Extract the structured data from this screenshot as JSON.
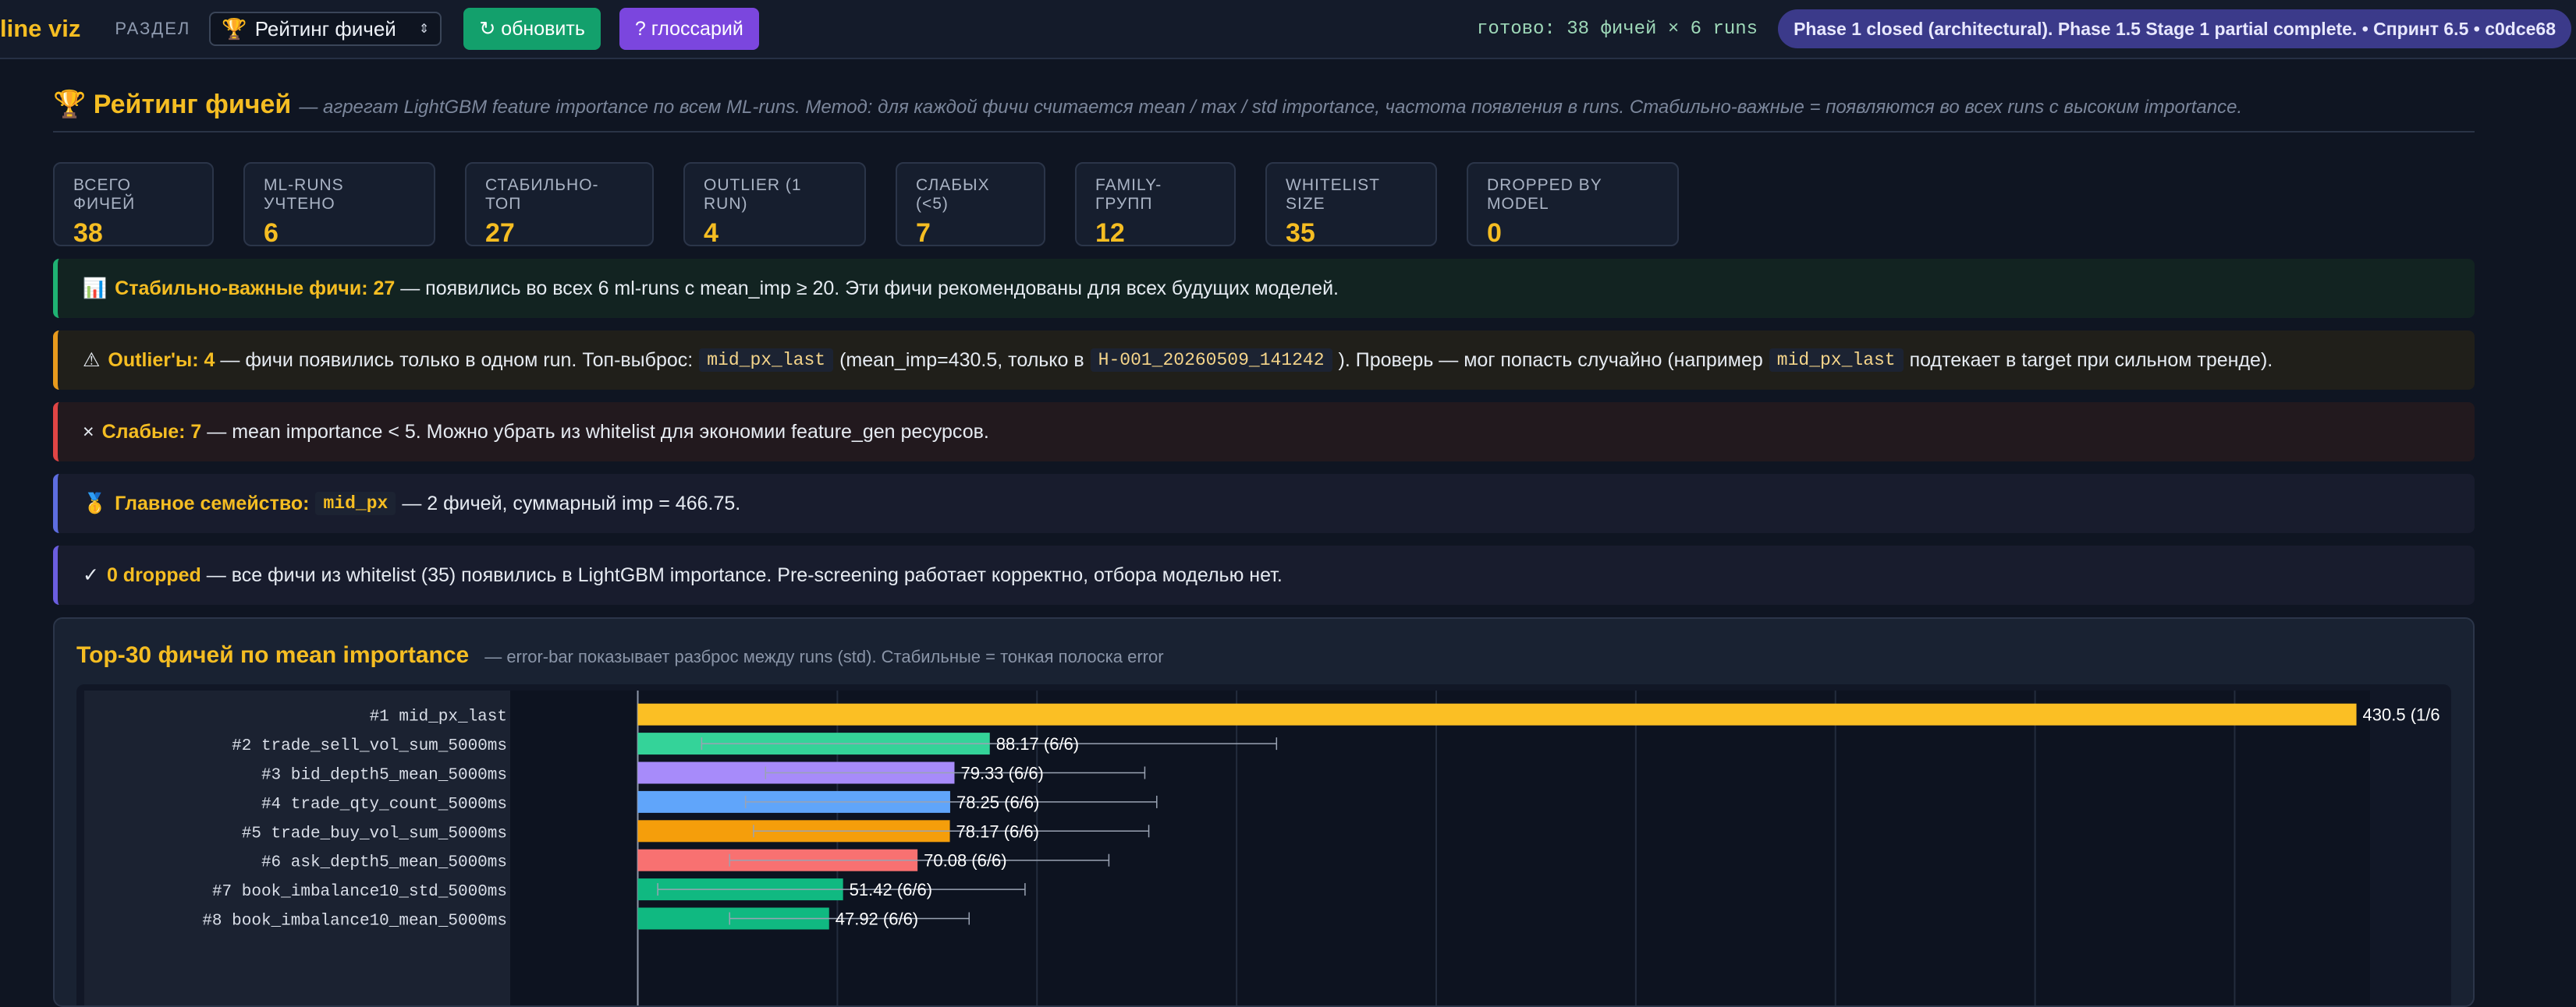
{
  "topbar": {
    "brand": "line viz",
    "section_label": "РАЗДЕЛ",
    "section_select": {
      "icon": "🏆",
      "value": "Рейтинг фичей"
    },
    "refresh_button": "↻ обновить",
    "glossary_button": "? глоссарий",
    "status": "готово: 38 фичей × 6 runs",
    "phase_pill": "Phase 1 closed (architectural). Phase 1.5 Stage 1 partial complete. • Спринт 6.5 • c0dce68"
  },
  "header": {
    "icon": "🏆",
    "title": "Рейтинг фичей",
    "subtitle": "— агрегат LightGBM feature importance по всем ML-runs. Метод: для каждой фичи считается mean / max / std importance, частота появления в runs. Стабильно-важные = появляются во всех runs с высоким importance."
  },
  "stats": [
    {
      "label": "ВСЕГО ФИЧЕЙ",
      "value": "38"
    },
    {
      "label": "ML-RUNS УЧТЕНО",
      "value": "6"
    },
    {
      "label": "СТАБИЛЬНО-ТОП",
      "value": "27"
    },
    {
      "label": "OUTLIER (1 RUN)",
      "value": "4"
    },
    {
      "label": "СЛАБЫХ (<5)",
      "value": "7"
    },
    {
      "label": "FAMILY-ГРУПП",
      "value": "12"
    },
    {
      "label": "WHITELIST SIZE",
      "value": "35"
    },
    {
      "label": "DROPPED BY MODEL",
      "value": "0"
    }
  ],
  "alerts": {
    "stable": {
      "icon": "📊",
      "bold": "Стабильно-важные фичи: 27",
      "text": " — появились во всех 6 ml-runs с mean_imp ≥ 20. Эти фичи рекомендованы для всех будущих моделей."
    },
    "outlier": {
      "icon": "⚠",
      "bold": "Outlier'ы: 4",
      "t1": " — фичи появились только в одном run. Топ-выброс:",
      "code1": "mid_px_last",
      "t2": "(mean_imp=430.5, только в",
      "code2": "H-001_20260509_141242",
      "t3": "). Проверь — мог попасть случайно (например",
      "code3": "mid_px_last",
      "t4": "подтекает в target при сильном тренде)."
    },
    "weak": {
      "icon": "×",
      "bold": "Слабые: 7",
      "text": " — mean importance < 5. Можно убрать из whitelist для экономии feature_gen ресурсов."
    },
    "family": {
      "icon": "🥇",
      "bold": "Главное семейство:",
      "code": "mid_px",
      "text": "— 2 фичей, суммарный imp = 466.75."
    },
    "dropped": {
      "icon": "✓",
      "bold": "0 dropped",
      "text": " — все фичи из whitelist (35) появились в LightGBM importance. Pre-screening работает корректно, отбора моделью нет."
    }
  },
  "chart_card": {
    "title": "Top-30 фичей по mean importance",
    "subtitle": "— error-bar показывает разброс между runs (std). Стабильные = тонкая полоска error"
  },
  "chart_data": {
    "type": "bar",
    "orientation": "horizontal",
    "xlim": [
      -30,
      430
    ],
    "grid": true,
    "categories": [
      "#1 mid_px_last",
      "#2 trade_sell_vol_sum_5000ms",
      "#3 bid_depth5_mean_5000ms",
      "#4 trade_qty_count_5000ms",
      "#5 trade_buy_vol_sum_5000ms",
      "#6 ask_depth5_mean_5000ms",
      "#7 book_imbalance10_std_5000ms",
      "#8 book_imbalance10_mean_5000ms"
    ],
    "values": [
      430.5,
      88.17,
      79.33,
      78.25,
      78.17,
      70.08,
      51.42,
      47.92
    ],
    "labels": [
      "430.5 (1/6",
      "88.17 (6/6)",
      "79.33 (6/6)",
      "78.25 (6/6)",
      "78.17 (6/6)",
      "70.08 (6/6)",
      "51.42 (6/6)",
      "47.92 (6/6)"
    ],
    "error_low": [
      430.5,
      16,
      32,
      27,
      29,
      23,
      5,
      23
    ],
    "error_high": [
      430.5,
      160,
      127,
      130,
      128,
      118,
      97,
      83
    ],
    "colors": [
      "#fbbf24",
      "#34d399",
      "#a78bfa",
      "#60a5fa",
      "#f59e0b",
      "#f87171",
      "#10b981",
      "#10b981"
    ]
  }
}
